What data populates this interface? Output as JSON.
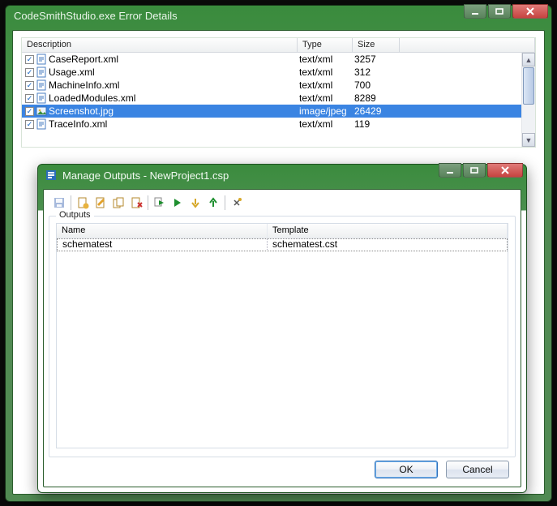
{
  "outer_window": {
    "title": "CodeSmithStudio.exe Error Details"
  },
  "error_list": {
    "columns": {
      "description": "Description",
      "type": "Type",
      "size": "Size"
    },
    "rows": [
      {
        "checked": true,
        "description": "CaseReport.xml",
        "type": "text/xml",
        "size": "3257",
        "icon": "xml",
        "selected": false
      },
      {
        "checked": true,
        "description": "Usage.xml",
        "type": "text/xml",
        "size": "312",
        "icon": "xml",
        "selected": false
      },
      {
        "checked": true,
        "description": "MachineInfo.xml",
        "type": "text/xml",
        "size": "700",
        "icon": "xml",
        "selected": false
      },
      {
        "checked": true,
        "description": "LoadedModules.xml",
        "type": "text/xml",
        "size": "8289",
        "icon": "xml",
        "selected": false
      },
      {
        "checked": true,
        "description": "Screenshot.jpg",
        "type": "image/jpeg",
        "size": "26429",
        "icon": "img",
        "selected": true
      },
      {
        "checked": true,
        "description": "TraceInfo.xml",
        "type": "text/xml",
        "size": "119",
        "icon": "xml",
        "selected": false
      }
    ]
  },
  "dialog": {
    "title": "Manage Outputs - NewProject1.csp",
    "group_label": "Outputs",
    "columns": {
      "name": "Name",
      "template": "Template"
    },
    "rows": [
      {
        "name": "schematest",
        "template": "schematest.cst"
      }
    ],
    "ok_label": "OK",
    "cancel_label": "Cancel"
  }
}
